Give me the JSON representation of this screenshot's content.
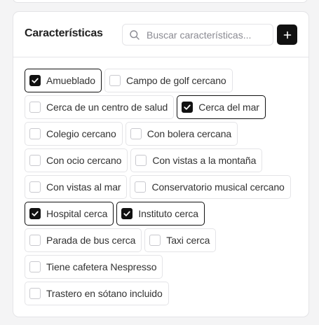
{
  "card": {
    "title": "Características",
    "search": {
      "placeholder": "Buscar características..."
    },
    "add_icon": "plus-icon"
  },
  "tags": {
    "rows": [
      [
        {
          "label": "Amueblado",
          "checked": true
        },
        {
          "label": "Campo de golf cercano",
          "checked": false
        }
      ],
      [
        {
          "label": "Cerca de un centro de salud",
          "checked": false
        },
        {
          "label": "Cerca del mar",
          "checked": true
        }
      ],
      [
        {
          "label": "Colegio cercano",
          "checked": false
        },
        {
          "label": "Con bolera cercana",
          "checked": false
        }
      ],
      [
        {
          "label": "Con ocio cercano",
          "checked": false
        },
        {
          "label": "Con vistas a la montaña",
          "checked": false
        }
      ],
      [
        {
          "label": "Con vistas al mar",
          "checked": false
        },
        {
          "label": "Conservatorio musical cercano",
          "checked": false
        }
      ],
      [
        {
          "label": "Hospital cerca",
          "checked": true
        },
        {
          "label": "Instituto cerca",
          "checked": true
        }
      ],
      [
        {
          "label": "Parada de bus cerca",
          "checked": false
        },
        {
          "label": "Taxi cerca",
          "checked": false
        }
      ],
      [
        {
          "label": "Tiene cafetera Nespresso",
          "checked": false
        }
      ],
      [
        {
          "label": "Trastero en sótano incluido",
          "checked": false
        }
      ]
    ]
  }
}
